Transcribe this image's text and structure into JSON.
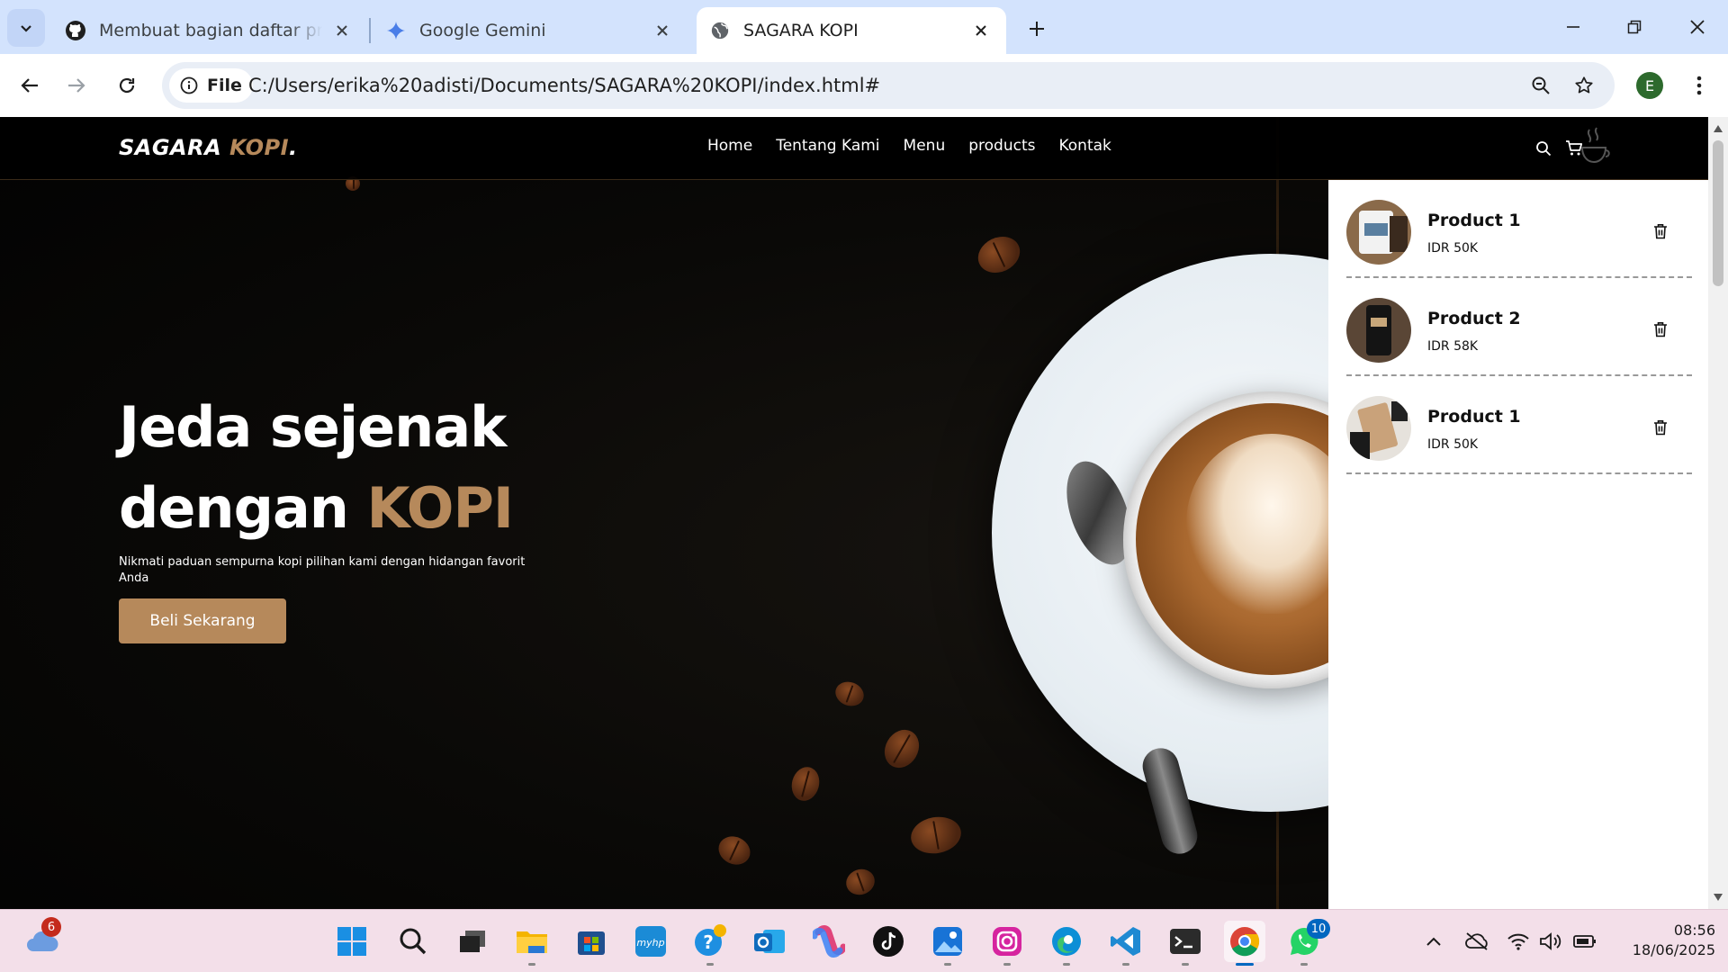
{
  "browser": {
    "tabs": [
      {
        "title": "Membuat bagian daftar produk",
        "icon": "github-icon"
      },
      {
        "title": "Google Gemini",
        "icon": "gemini-icon"
      },
      {
        "title": "SAGARA KOPI",
        "icon": "globe-icon"
      }
    ],
    "address": {
      "scheme_label": "File",
      "url": "C:/Users/erika%20adisti/Documents/SAGARA%20KOPI/index.html#"
    },
    "profile_initial": "E"
  },
  "site": {
    "logo": {
      "main": "SAGARA ",
      "accent": "KOPI",
      "suffix": "."
    },
    "nav": [
      "Home",
      "Tentang Kami",
      "Menu",
      "products",
      "Kontak"
    ],
    "hero": {
      "line1": "Jeda sejenak",
      "line2_prefix": "dengan ",
      "line2_accent": "KOPI",
      "description": "Nikmati paduan sempurna kopi pilihan kami dengan hidangan favorit Anda",
      "cta": "Beli Sekarang"
    },
    "cart": {
      "items": [
        {
          "name": "Product 1",
          "price": "IDR 50K"
        },
        {
          "name": "Product 2",
          "price": "IDR 58K"
        },
        {
          "name": "Product 1",
          "price": "IDR 50K"
        }
      ]
    },
    "colors": {
      "accent": "#b6895b",
      "background": "#060606"
    }
  },
  "taskbar": {
    "weather_badge": "6",
    "whatsapp_badge": "10",
    "time": "08:56",
    "date": "18/06/2025"
  }
}
